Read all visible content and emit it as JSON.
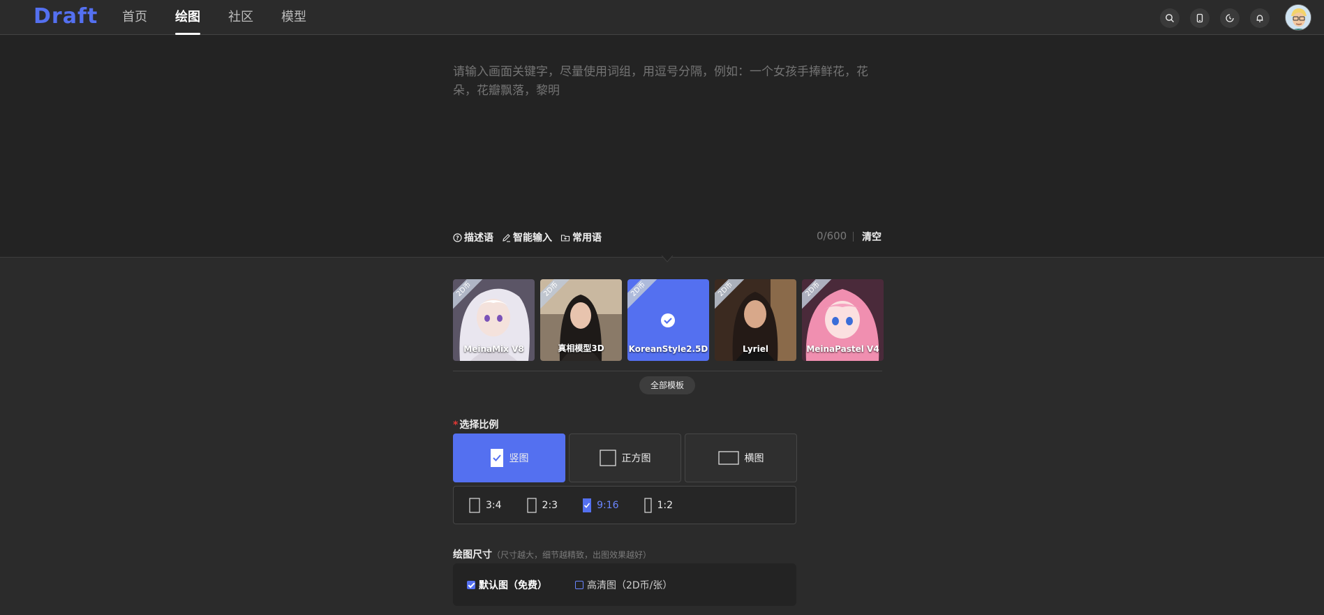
{
  "header": {
    "logo": "Draft",
    "nav": [
      {
        "label": "首页",
        "active": false
      },
      {
        "label": "绘图",
        "active": true
      },
      {
        "label": "社区",
        "active": false
      },
      {
        "label": "模型",
        "active": false
      }
    ],
    "icons": [
      "search-icon",
      "mobile-icon",
      "history-icon",
      "bell-icon"
    ]
  },
  "prompt": {
    "placeholder": "请输入画面关键字，尽量使用词组，用逗号分隔，例如：一个女孩手捧鲜花，花朵，花瓣飘落，黎明",
    "value": "",
    "tools": [
      {
        "label": "描述语",
        "icon": "help-circle-icon"
      },
      {
        "label": "智能输入",
        "icon": "pencil-icon"
      },
      {
        "label": "常用语",
        "icon": "folder-plus-icon"
      }
    ],
    "counter": "0/600",
    "clear_label": "清空"
  },
  "templates": {
    "items": [
      {
        "name": "MeinaMix V8",
        "badge": "2D币",
        "selected": false
      },
      {
        "name": "真相模型3D",
        "badge": "2D币",
        "selected": false
      },
      {
        "name": "KoreanStyle2.5D",
        "badge": "2D币",
        "selected": true
      },
      {
        "name": "Lyriel",
        "badge": "2D币",
        "selected": false
      },
      {
        "name": "MeinaPastel V4",
        "badge": "2D币",
        "selected": false
      }
    ],
    "all_label": "全部模板"
  },
  "ratio": {
    "title": "选择比例",
    "required_mark": "*",
    "options": [
      {
        "label": "竖图",
        "selected": true
      },
      {
        "label": "正方图",
        "selected": false
      },
      {
        "label": "横图",
        "selected": false
      }
    ],
    "sub_options": [
      {
        "label": "3:4",
        "selected": false
      },
      {
        "label": "2:3",
        "selected": false
      },
      {
        "label": "9:16",
        "selected": true
      },
      {
        "label": "1:2",
        "selected": false
      }
    ]
  },
  "size": {
    "title": "绘图尺寸",
    "hint": "（尺寸越大，细节越精致，出图效果越好）",
    "options": [
      {
        "label": "默认图（免费）",
        "selected": true
      },
      {
        "label": "高清图（2D币/张）",
        "selected": false
      }
    ]
  },
  "colors": {
    "accent": "#5470f0",
    "background": "#2b2b2b",
    "panel": "#232323"
  }
}
